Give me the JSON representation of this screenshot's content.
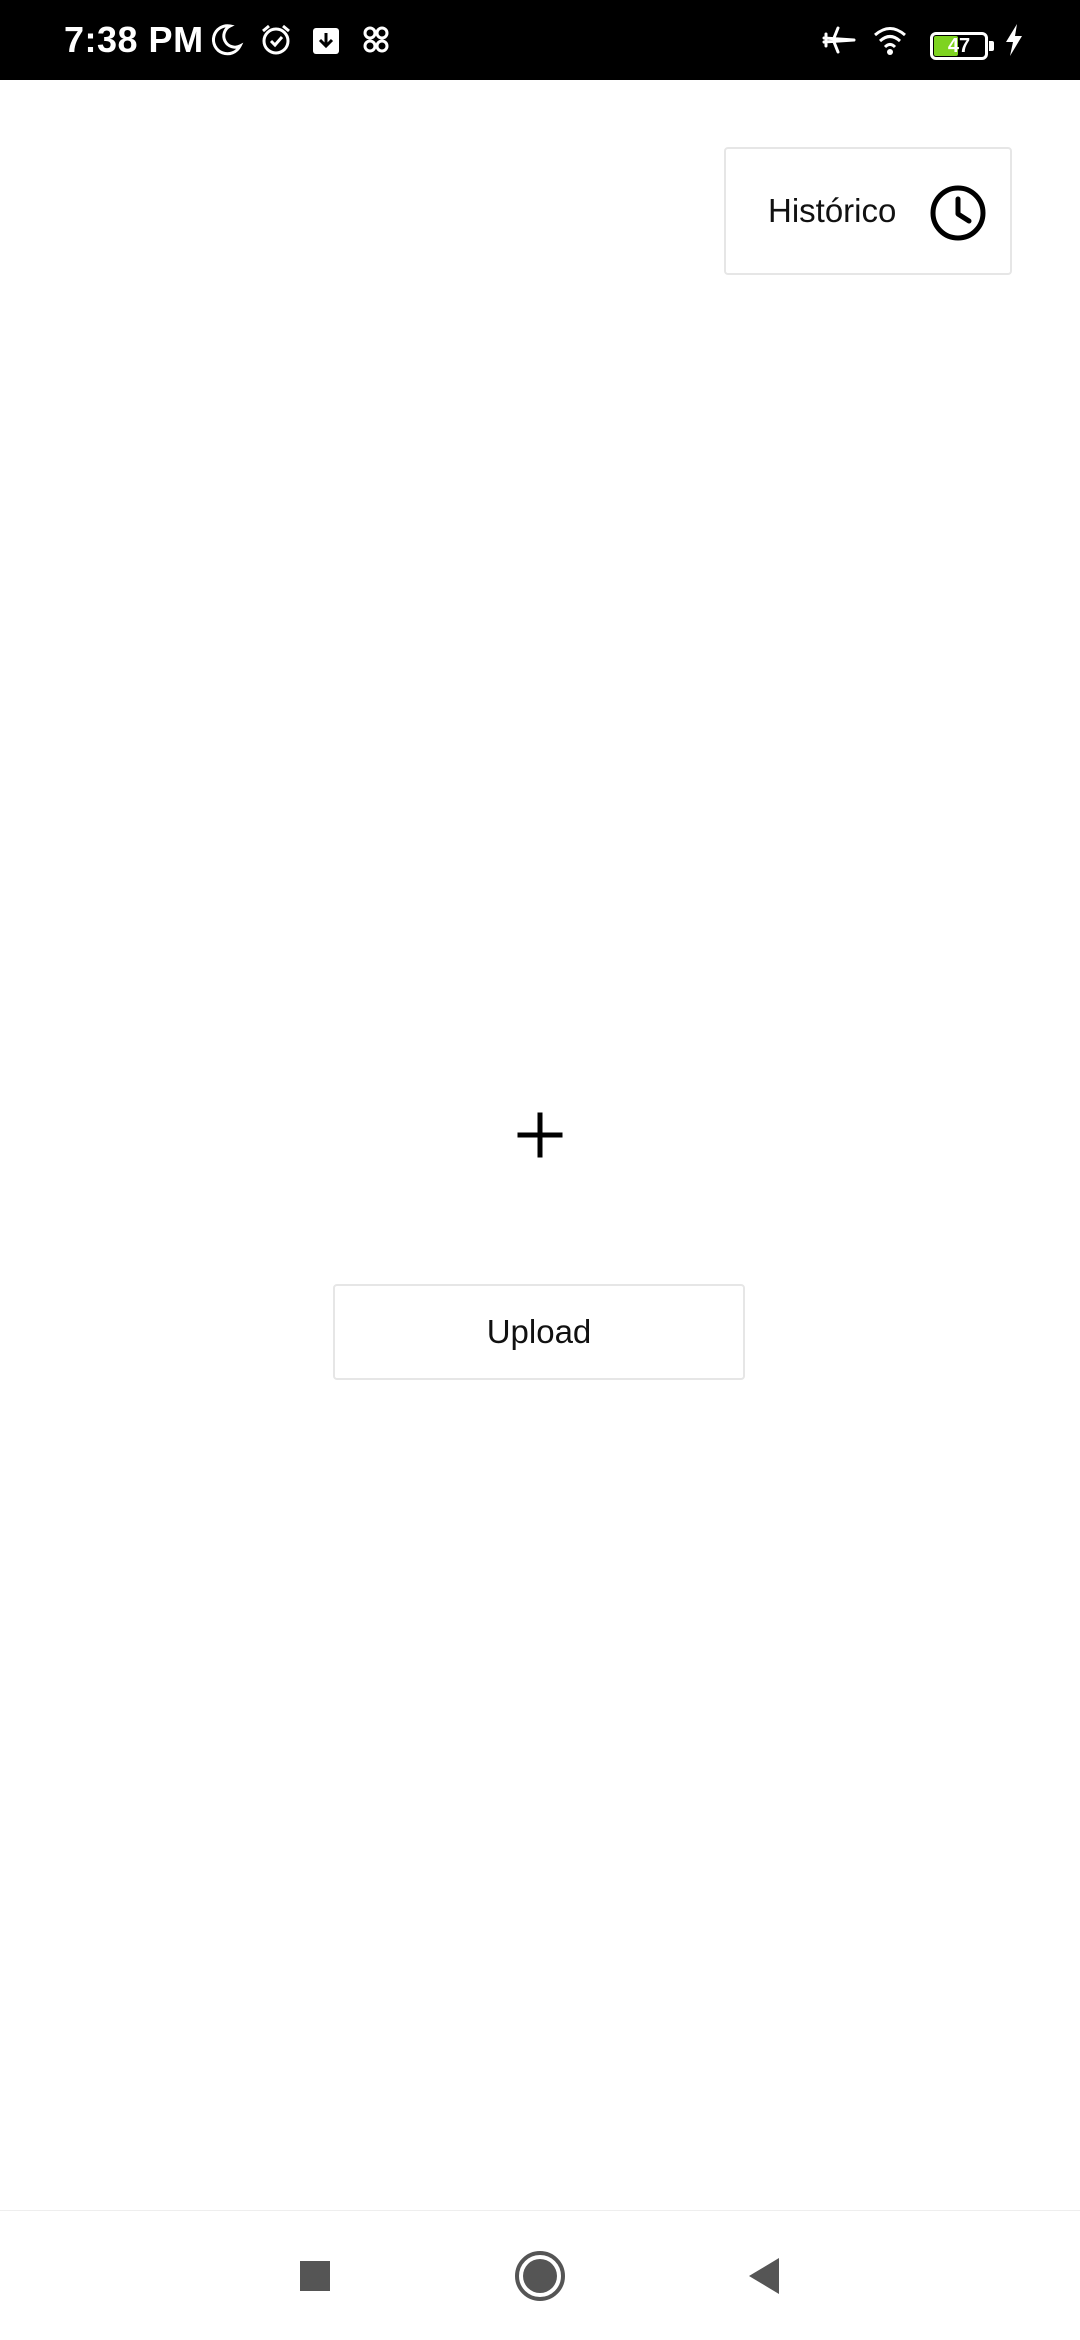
{
  "status_bar": {
    "time": "7:38 PM",
    "battery_level": "47",
    "battery_fraction": 0.47,
    "icons": [
      "moon-icon",
      "alarm-icon",
      "download-icon",
      "app-notification-icon",
      "airplane-mode-icon",
      "wifi-icon",
      "battery-icon",
      "charging-icon"
    ]
  },
  "header": {
    "history_label": "Histórico",
    "history_icon": "clock-icon"
  },
  "main": {
    "add_icon": "plus-icon",
    "upload_label": "Upload"
  },
  "nav_bar": {
    "icons": [
      "recents-square-icon",
      "home-circle-icon",
      "back-triangle-icon"
    ]
  },
  "colors": {
    "status_bar_bg": "#000000",
    "background": "#ffffff",
    "border": "#e6e6e6",
    "battery_fill": "#7ed321",
    "nav_icon": "#555555"
  }
}
